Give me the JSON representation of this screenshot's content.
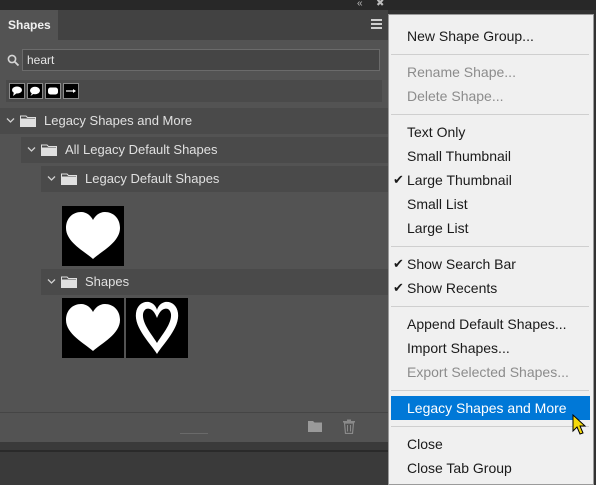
{
  "panel": {
    "tab_label": "Shapes",
    "search": {
      "value": "heart",
      "placeholder": ""
    },
    "recent_shapes": [
      "speech-bubble-icon",
      "speech-bubble-round-icon",
      "rounded-rectangle-icon",
      "arrow-icon"
    ],
    "tree": {
      "root": "Legacy Shapes and More",
      "child": "All Legacy Default Shapes",
      "subgroups": [
        {
          "label": "Legacy Default Shapes",
          "thumbs": [
            "heart-filled"
          ]
        },
        {
          "label": "Shapes",
          "thumbs": [
            "heart-filled",
            "heart-outline"
          ]
        }
      ]
    }
  },
  "menu": {
    "items": [
      {
        "label": "New Shape Group...",
        "enabled": true,
        "checked": false
      },
      {
        "label": "Rename Shape...",
        "enabled": false,
        "checked": false
      },
      {
        "label": "Delete Shape...",
        "enabled": false,
        "checked": false
      },
      {
        "label": "Text Only",
        "enabled": true,
        "checked": false
      },
      {
        "label": "Small Thumbnail",
        "enabled": true,
        "checked": false
      },
      {
        "label": "Large Thumbnail",
        "enabled": true,
        "checked": true
      },
      {
        "label": "Small List",
        "enabled": true,
        "checked": false
      },
      {
        "label": "Large List",
        "enabled": true,
        "checked": false
      },
      {
        "label": "Show Search Bar",
        "enabled": true,
        "checked": true
      },
      {
        "label": "Show Recents",
        "enabled": true,
        "checked": true
      },
      {
        "label": "Append Default Shapes...",
        "enabled": true,
        "checked": false
      },
      {
        "label": "Import Shapes...",
        "enabled": true,
        "checked": false
      },
      {
        "label": "Export Selected Shapes...",
        "enabled": false,
        "checked": false
      },
      {
        "label": "Legacy Shapes and More",
        "enabled": true,
        "checked": false,
        "highlighted": true
      },
      {
        "label": "Close",
        "enabled": true,
        "checked": false
      },
      {
        "label": "Close Tab Group",
        "enabled": true,
        "checked": false
      }
    ],
    "highlight_color": "#0078d7"
  },
  "colors": {
    "panel_bg": "#535353",
    "group_row_bg": "#4a4a4a",
    "menu_bg": "#f0f0f0"
  }
}
